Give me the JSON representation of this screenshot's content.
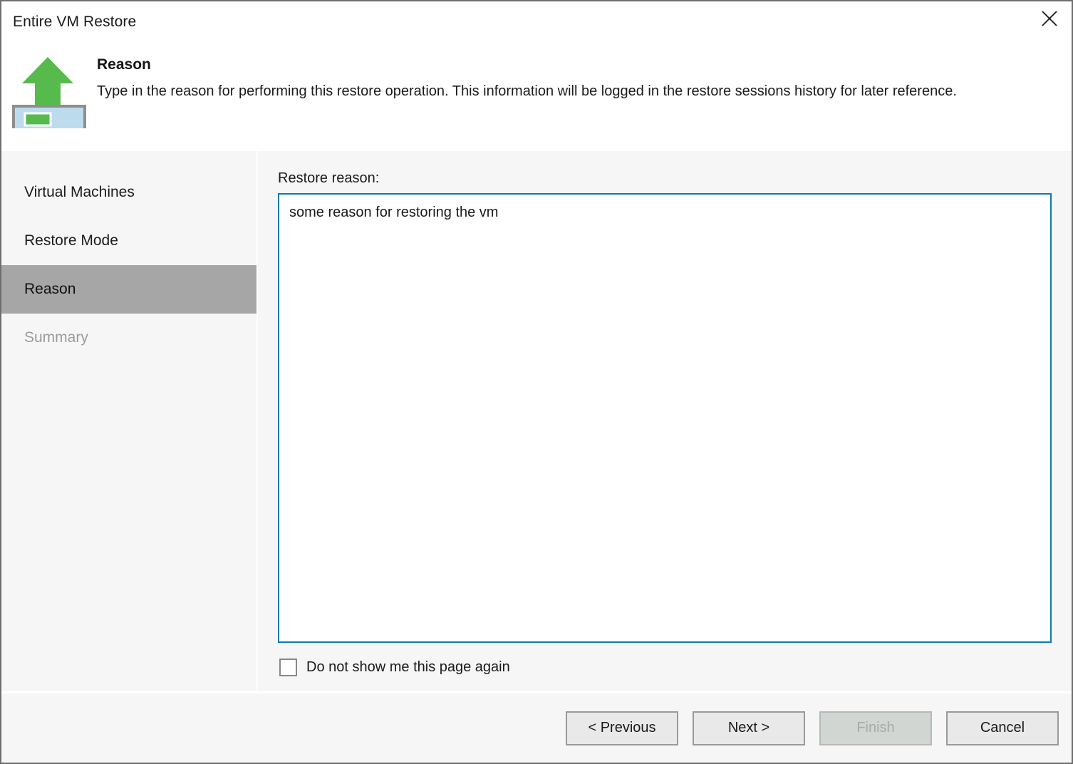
{
  "window": {
    "title": "Entire VM Restore",
    "close_icon": "close-icon"
  },
  "header": {
    "icon": "vm-restore-up-arrow-icon",
    "title": "Reason",
    "description": "Type in the reason for performing this restore operation. This information will be logged in the restore sessions history for later reference."
  },
  "sidebar": {
    "items": [
      {
        "label": "Virtual Machines",
        "state": "normal"
      },
      {
        "label": "Restore Mode",
        "state": "normal"
      },
      {
        "label": "Reason",
        "state": "selected"
      },
      {
        "label": "Summary",
        "state": "disabled"
      }
    ]
  },
  "main": {
    "reason_label": "Restore reason:",
    "reason_value": "some reason for restoring the vm",
    "reason_placeholder": "",
    "dont_show_label": "Do not show me this page again",
    "dont_show_checked": false
  },
  "footer": {
    "buttons": [
      {
        "label": "< Previous",
        "enabled": true
      },
      {
        "label": "Next >",
        "enabled": true
      },
      {
        "label": "Finish",
        "enabled": false
      },
      {
        "label": "Cancel",
        "enabled": true
      }
    ]
  },
  "colors": {
    "accent": "#0b79b8",
    "selected_nav": "#a6a6a6",
    "panel": "#f6f6f6",
    "icon_green": "#56bb4c",
    "icon_blue": "#bcdcee"
  }
}
